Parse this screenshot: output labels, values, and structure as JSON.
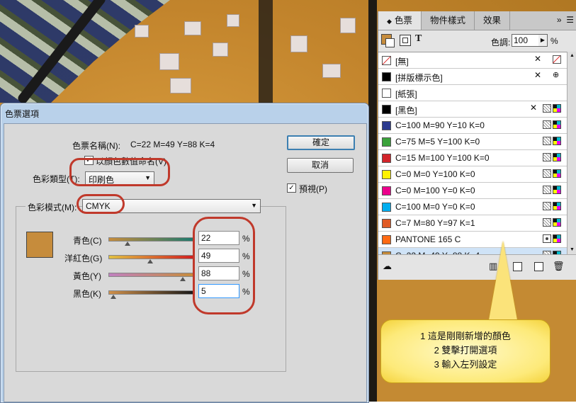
{
  "swatches_panel": {
    "tabs": [
      "色票",
      "物件樣式",
      "效果"
    ],
    "tint_label": "色調:",
    "tint_value": "100",
    "tint_unit": "%",
    "swatches": [
      {
        "name": "[無]",
        "color": "none"
      },
      {
        "name": "[拼版標示色]",
        "color": "#000000"
      },
      {
        "name": "[紙張]",
        "color": "#ffffff"
      },
      {
        "name": "[黑色]",
        "color": "#000000"
      },
      {
        "name": "C=100 M=90 Y=10 K=0",
        "color": "#2b3a8f"
      },
      {
        "name": "C=75 M=5 Y=100 K=0",
        "color": "#3aa23a"
      },
      {
        "name": "C=15 M=100 Y=100 K=0",
        "color": "#d2232a"
      },
      {
        "name": "C=0 M=0 Y=100 K=0",
        "color": "#fff200"
      },
      {
        "name": "C=0 M=100 Y=0 K=0",
        "color": "#ec008c"
      },
      {
        "name": "C=100 M=0 Y=0 K=0",
        "color": "#00aeef"
      },
      {
        "name": "C=7 M=80 Y=97 K=1",
        "color": "#e05a24"
      },
      {
        "name": "PANTONE 165 C",
        "color": "#ff6a13"
      },
      {
        "name": "C=22 M=49 Y=88 K=4",
        "color": "#c68c3c"
      }
    ]
  },
  "dialog": {
    "title": "色票選項",
    "swatch_name_label": "色票名稱(N):",
    "swatch_name_value": "C=22 M=49 Y=88 K=4",
    "name_with_value_label": "以顏色數值命名(V)",
    "color_type_label": "色彩類型(T):",
    "color_type_value": "印刷色",
    "color_mode_label": "色彩模式(M):",
    "color_mode_value": "CMYK",
    "ok_label": "確定",
    "cancel_label": "取消",
    "preview_label": "預視(P)",
    "preview_color": "#c68c3c",
    "channels": [
      {
        "label": "青色(C)",
        "value": "22",
        "unit": "%",
        "fraction": 0.22
      },
      {
        "label": "洋紅色(G)",
        "value": "49",
        "unit": "%",
        "fraction": 0.49
      },
      {
        "label": "黃色(Y)",
        "value": "88",
        "unit": "%",
        "fraction": 0.88
      },
      {
        "label": "黑色(K)",
        "value": "5",
        "unit": "%",
        "fraction": 0.05
      }
    ]
  },
  "callout": {
    "line1": "1 這是剛剛新增的顏色",
    "line2": "2 雙擊打開選項",
    "line3": "3 輸入左列設定"
  }
}
